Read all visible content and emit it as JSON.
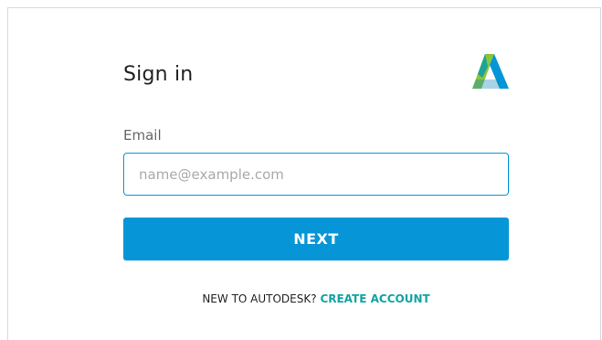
{
  "signin": {
    "title": "Sign in",
    "email_label": "Email",
    "email_placeholder": "name@example.com",
    "email_value": "",
    "next_label": "NEXT",
    "new_prompt": "NEW TO AUTODESK?",
    "create_account_label": "CREATE ACCOUNT"
  },
  "logo": {
    "icon": "autodesk-logo-icon"
  },
  "colors": {
    "accent": "#0696d7",
    "link": "#12a3a3",
    "logo_green": "#8bc53f",
    "logo_teal": "#1aa596",
    "logo_blue": "#0696d7"
  }
}
